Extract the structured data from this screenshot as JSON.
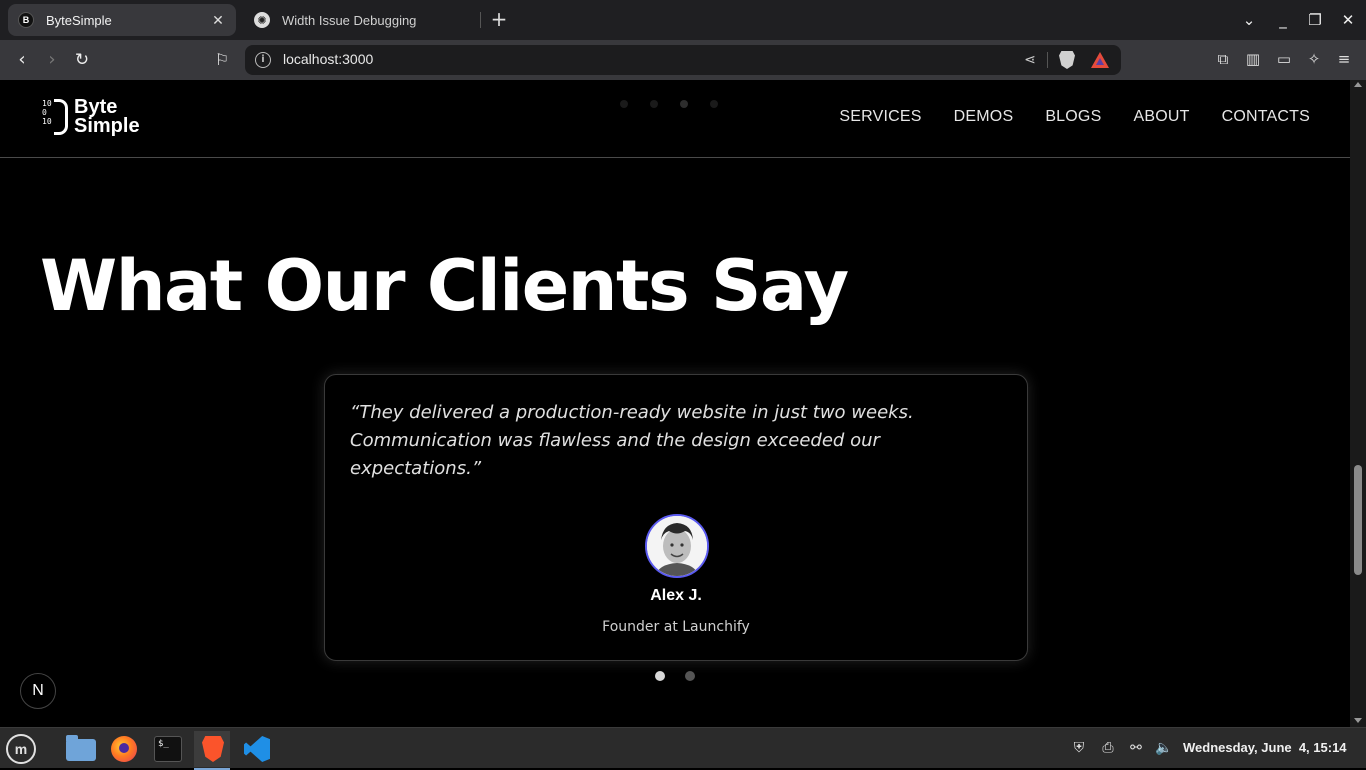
{
  "browser": {
    "tabs": [
      {
        "title": "ByteSimple",
        "favicon": "B",
        "active": true
      },
      {
        "title": "Width Issue Debugging",
        "favicon": "✺",
        "active": false
      }
    ],
    "address": "localhost:3000",
    "close_tab_glyph": "✕",
    "new_tab_glyph": "+"
  },
  "site": {
    "logo": {
      "bits": [
        "10",
        "0",
        "10"
      ],
      "line1": "Byte",
      "line2": "Simple"
    },
    "nav": [
      "SERVICES",
      "DEMOS",
      "BLOGS",
      "ABOUT",
      "CONTACTS"
    ]
  },
  "testimonials": {
    "heading": "What Our Clients Say",
    "quote": "“They delivered a production-ready website in just two weeks. Communication was flawless and the design exceeded our expectations.”",
    "author": "Alex J.",
    "role": "Founder at Launchify",
    "slides": 2,
    "active_slide": 1,
    "avatar_ring_color": "#5b5bf0"
  },
  "dev_badge": "N",
  "taskbar": {
    "menu_glyph": "m",
    "terminal_glyph": "$_",
    "clock": "Wednesday, June  4, 15:14",
    "active_app": "brave"
  }
}
